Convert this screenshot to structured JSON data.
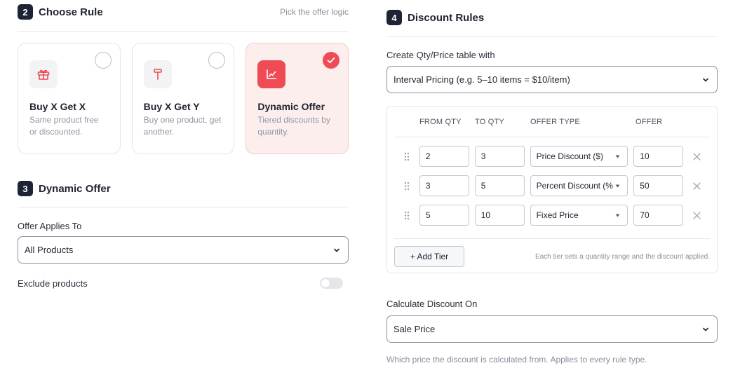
{
  "choose_rule": {
    "step": "2",
    "title": "Choose Rule",
    "hint": "Pick the offer logic",
    "cards": [
      {
        "title": "Buy X Get X",
        "desc": "Same product free or discounted.",
        "icon": "gift-icon",
        "selected": false
      },
      {
        "title": "Buy X Get Y",
        "desc": "Buy one product, get another.",
        "icon": "hammer-icon",
        "selected": false
      },
      {
        "title": "Dynamic Offer",
        "desc": "Tiered discounts by quantity.",
        "icon": "trend-chart-icon",
        "selected": true
      }
    ]
  },
  "dynamic_offer": {
    "step": "3",
    "title": "Dynamic Offer",
    "applies_label": "Offer Applies To",
    "applies_value": "All Products",
    "exclude_label": "Exclude products",
    "exclude_enabled": false
  },
  "discount_rules": {
    "step": "4",
    "title": "Discount Rules",
    "table_with_label": "Create Qty/Price table with",
    "table_with_value": "Interval Pricing (e.g. 5–10 items = $10/item)",
    "columns": [
      "FROM QTY",
      "TO QTY",
      "OFFER TYPE",
      "OFFER"
    ],
    "tiers": [
      {
        "from": "2",
        "to": "3",
        "type": "Price Discount ($)",
        "offer": "10"
      },
      {
        "from": "3",
        "to": "5",
        "type": "Percent Discount (%",
        "offer": "50"
      },
      {
        "from": "5",
        "to": "10",
        "type": "Fixed Price",
        "offer": "70"
      }
    ],
    "add_tier_label": "+ Add Tier",
    "tier_note": "Each tier sets a quantity range and the discount applied.",
    "calc_label": "Calculate Discount On",
    "calc_value": "Sale Price",
    "calc_help": "Which price the discount is calculated from. Applies to every rule type."
  },
  "colors": {
    "accent": "#ef4b55",
    "step_badge": "#1e2435",
    "selected_card_bg": "#fdeeee"
  }
}
